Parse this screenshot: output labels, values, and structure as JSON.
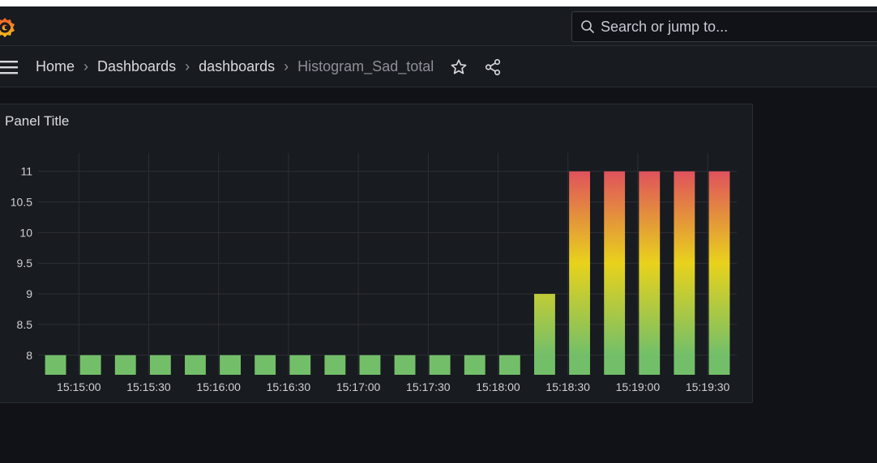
{
  "topbar": {
    "logo": "grafana-logo-icon",
    "search": {
      "icon": "search-icon",
      "placeholder": "Search or jump to..."
    }
  },
  "navbar": {
    "menu_icon": "hamburger-menu-icon",
    "breadcrumbs": [
      "Home",
      "Dashboards",
      "dashboards",
      "Histogram_Sad_total"
    ],
    "separator": "›",
    "star_icon": "star-icon",
    "share_icon": "share-icon"
  },
  "panel": {
    "title": "Panel Title"
  },
  "colors": {
    "background": "#111217",
    "panel": "#181b1f",
    "green": "#73bf69",
    "yellow": "#e8d21c",
    "red": "#e0525c"
  },
  "chart_data": {
    "type": "bar",
    "title": "Panel Title",
    "xlabel": "",
    "ylabel": "",
    "ylim": [
      7.68,
      11.3
    ],
    "yticks": [
      8,
      8.5,
      9,
      9.5,
      10,
      10.5,
      11
    ],
    "ytick_labels": [
      "8",
      "8.5",
      "9",
      "9.5",
      "10",
      "10.5",
      "11"
    ],
    "xtick_labels": [
      "15:15:00",
      "15:15:30",
      "15:16:00",
      "15:16:30",
      "15:17:00",
      "15:17:30",
      "15:18:00",
      "15:18:30",
      "15:19:00",
      "15:19:30"
    ],
    "x_first_time": "15:14:50",
    "x_interval_seconds": 15,
    "values": [
      8,
      8,
      8,
      8,
      8,
      8,
      8,
      8,
      8,
      8,
      8,
      8,
      8,
      8,
      9,
      11,
      11,
      11,
      11,
      11
    ],
    "grid": true,
    "legend": "none",
    "color_scheme": "green-yellow-red gradient by value"
  }
}
